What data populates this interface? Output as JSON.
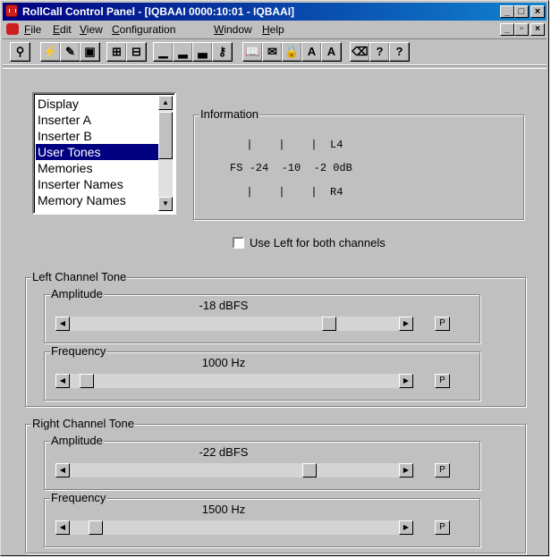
{
  "window": {
    "title": "RollCall Control Panel - [IQBAAI 0000:10:01 - IQBAAI]",
    "caption_buttons": [
      "_",
      "□",
      "×"
    ]
  },
  "menu": {
    "items": [
      {
        "label": "File",
        "accel": "F"
      },
      {
        "label": "Edit",
        "accel": "E"
      },
      {
        "label": "View",
        "accel": "V"
      },
      {
        "label": "Configuration",
        "accel": "C"
      },
      {
        "label": "Window",
        "accel": "W"
      },
      {
        "label": "Help",
        "accel": "H"
      }
    ],
    "mdi_buttons": [
      "_",
      "▫",
      "×"
    ]
  },
  "toolbar": {
    "buttons": [
      {
        "name": "connect-icon",
        "glyph": "⚲"
      },
      {
        "name": "flash-icon",
        "glyph": "⚡"
      },
      {
        "name": "edit-icon",
        "glyph": "✎"
      },
      {
        "name": "save-icon",
        "glyph": "▣"
      },
      {
        "name": "network-icon",
        "glyph": "⊞"
      },
      {
        "name": "device-icon",
        "glyph": "⊟"
      },
      {
        "name": "signal-low-icon",
        "glyph": "▁"
      },
      {
        "name": "signal-mid-icon",
        "glyph": "▂"
      },
      {
        "name": "signal-high-icon",
        "glyph": "▃"
      },
      {
        "name": "key-icon",
        "glyph": "⚷"
      },
      {
        "name": "book-icon",
        "glyph": "📖"
      },
      {
        "name": "notes-icon",
        "glyph": "✉"
      },
      {
        "name": "lock-icon",
        "glyph": "🔒"
      },
      {
        "name": "font-a-icon",
        "glyph": "A"
      },
      {
        "name": "font-a-green-icon",
        "glyph": "A"
      },
      {
        "name": "eraser-icon",
        "glyph": "⌫"
      },
      {
        "name": "help-index-icon",
        "glyph": "?"
      },
      {
        "name": "help-icon",
        "glyph": "?"
      }
    ]
  },
  "list": {
    "items": [
      "Display",
      "Inserter A",
      "Inserter B",
      "User Tones",
      "Memories",
      "Inserter Names",
      "Memory Names"
    ],
    "selected_index": 3
  },
  "information": {
    "title": "Information",
    "line1": "  |    |    |  L4",
    "line2": "FS -24  -10  -2 0dB",
    "line3": "  |    |    |  R4"
  },
  "options": {
    "use_left_label": "Use Left for both channels",
    "use_left_checked": false
  },
  "left_channel": {
    "title": "Left Channel Tone",
    "amplitude": {
      "label": "Amplitude",
      "value": "-18 dBFS",
      "position": 0.8
    },
    "frequency": {
      "label": "Frequency",
      "value": "1000 Hz",
      "position": 0.03
    }
  },
  "right_channel": {
    "title": "Right Channel Tone",
    "amplitude": {
      "label": "Amplitude",
      "value": "-22 dBFS",
      "position": 0.74
    },
    "frequency": {
      "label": "Frequency",
      "value": "1500 Hz",
      "position": 0.06
    }
  },
  "preset_button_label": "P",
  "scroll_glyphs": {
    "left": "◀",
    "right": "▶",
    "up": "▲",
    "down": "▼"
  }
}
